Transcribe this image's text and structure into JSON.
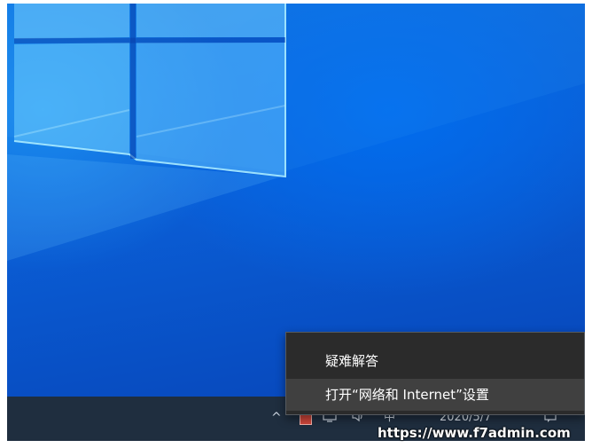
{
  "desktop": {
    "wallpaper": "windows-10-hero",
    "colors": {
      "primary": "#0a5ed6",
      "light": "#3fb0ff",
      "deep": "#0745b8"
    }
  },
  "taskbar": {
    "color": "#1f2e3f",
    "tray": {
      "chevron_icon": "chevron-up-icon",
      "ime_label": "中",
      "date": "2020/5/7"
    }
  },
  "context_menu": {
    "items": [
      {
        "label": "疑难解答"
      },
      {
        "label": "打开“网络和 Internet”设置"
      }
    ]
  },
  "watermark": {
    "text": "https://www.f7admin.com"
  }
}
